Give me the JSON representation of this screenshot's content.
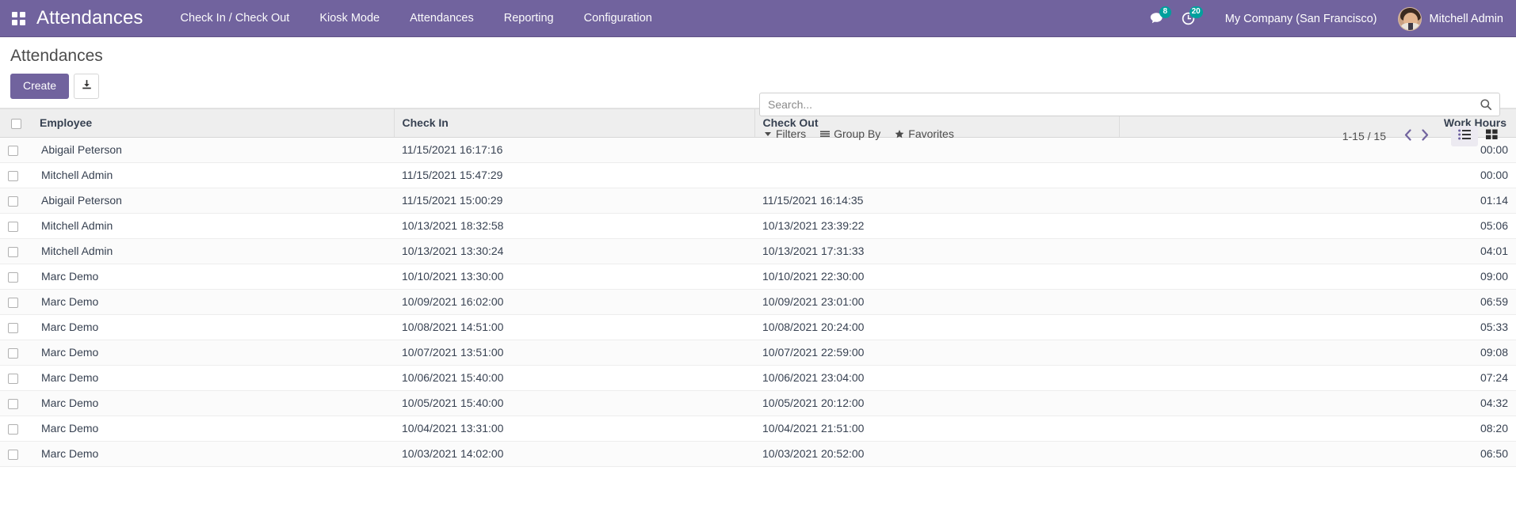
{
  "navbar": {
    "apps_icon": "apps-grid-icon",
    "brand": "Attendances",
    "menu_items": [
      {
        "label": "Check In / Check Out"
      },
      {
        "label": "Kiosk Mode"
      },
      {
        "label": "Attendances"
      },
      {
        "label": "Reporting"
      },
      {
        "label": "Configuration"
      }
    ],
    "messages_icon": "messages-icon",
    "messages_badge": "8",
    "activities_icon": "activities-clock-icon",
    "activities_badge": "20",
    "company": "My Company (San Francisco)",
    "user_name": "Mitchell Admin",
    "accent_color": "#71639e",
    "badge_color": "#00a09d"
  },
  "control_panel": {
    "title": "Attendances",
    "create_label": "Create",
    "import_icon": "import-download-icon",
    "search": {
      "placeholder": "Search...",
      "value": "",
      "icon": "search-icon"
    },
    "filters": [
      {
        "label": "Filters",
        "icon": "filter-caret-icon"
      },
      {
        "label": "Group By",
        "icon": "group-by-bars-icon"
      },
      {
        "label": "Favorites",
        "icon": "favorites-star-icon"
      }
    ],
    "pager": {
      "value": "1-15 / 15",
      "previous_icon": "chevron-left-icon",
      "next_icon": "chevron-right-icon"
    },
    "views": [
      {
        "name": "list",
        "icon": "list-view-icon",
        "active": true
      },
      {
        "name": "kanban",
        "icon": "kanban-view-icon",
        "active": false
      }
    ]
  },
  "table": {
    "select_all_checkbox": "select-all-checkbox",
    "columns": [
      "Employee",
      "Check In",
      "Check Out",
      "Work Hours"
    ],
    "rows": [
      {
        "employee": "Abigail Peterson",
        "check_in": "11/15/2021 16:17:16",
        "check_out": "",
        "work_hours": "00:00"
      },
      {
        "employee": "Mitchell Admin",
        "check_in": "11/15/2021 15:47:29",
        "check_out": "",
        "work_hours": "00:00"
      },
      {
        "employee": "Abigail Peterson",
        "check_in": "11/15/2021 15:00:29",
        "check_out": "11/15/2021 16:14:35",
        "work_hours": "01:14"
      },
      {
        "employee": "Mitchell Admin",
        "check_in": "10/13/2021 18:32:58",
        "check_out": "10/13/2021 23:39:22",
        "work_hours": "05:06"
      },
      {
        "employee": "Mitchell Admin",
        "check_in": "10/13/2021 13:30:24",
        "check_out": "10/13/2021 17:31:33",
        "work_hours": "04:01"
      },
      {
        "employee": "Marc Demo",
        "check_in": "10/10/2021 13:30:00",
        "check_out": "10/10/2021 22:30:00",
        "work_hours": "09:00"
      },
      {
        "employee": "Marc Demo",
        "check_in": "10/09/2021 16:02:00",
        "check_out": "10/09/2021 23:01:00",
        "work_hours": "06:59"
      },
      {
        "employee": "Marc Demo",
        "check_in": "10/08/2021 14:51:00",
        "check_out": "10/08/2021 20:24:00",
        "work_hours": "05:33"
      },
      {
        "employee": "Marc Demo",
        "check_in": "10/07/2021 13:51:00",
        "check_out": "10/07/2021 22:59:00",
        "work_hours": "09:08"
      },
      {
        "employee": "Marc Demo",
        "check_in": "10/06/2021 15:40:00",
        "check_out": "10/06/2021 23:04:00",
        "work_hours": "07:24"
      },
      {
        "employee": "Marc Demo",
        "check_in": "10/05/2021 15:40:00",
        "check_out": "10/05/2021 20:12:00",
        "work_hours": "04:32"
      },
      {
        "employee": "Marc Demo",
        "check_in": "10/04/2021 13:31:00",
        "check_out": "10/04/2021 21:51:00",
        "work_hours": "08:20"
      },
      {
        "employee": "Marc Demo",
        "check_in": "10/03/2021 14:02:00",
        "check_out": "10/03/2021 20:52:00",
        "work_hours": "06:50"
      }
    ]
  }
}
